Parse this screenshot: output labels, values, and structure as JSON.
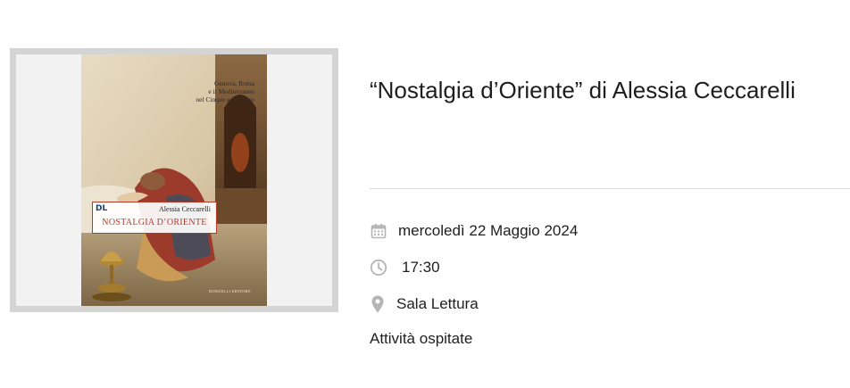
{
  "event": {
    "title": "“Nostalgia d’Oriente” di Alessia Ceccarelli",
    "date": "mercoledì 22 Maggio 2024",
    "time": "17:30",
    "place": "Sala Lettura",
    "category": "Attività ospitate"
  },
  "book_cover": {
    "subtitle": "Genova, Roma\ne il Mediterraneo\nnel Cinque e Seicento",
    "logo": "DL",
    "author": "Alessia Ceccarelli",
    "title": "NOSTALGIA D’ORIENTE",
    "publisher": "DONZELLI EDITORE"
  },
  "icons": {
    "date": "calendar-icon",
    "time": "clock-icon",
    "place": "map-pin-icon"
  },
  "colors": {
    "text": "#1e1e1e",
    "icon": "#b5b5b5",
    "divider": "#dcdcdc",
    "frame": "#d4d4d4",
    "cover_accent": "#b73a2b"
  }
}
